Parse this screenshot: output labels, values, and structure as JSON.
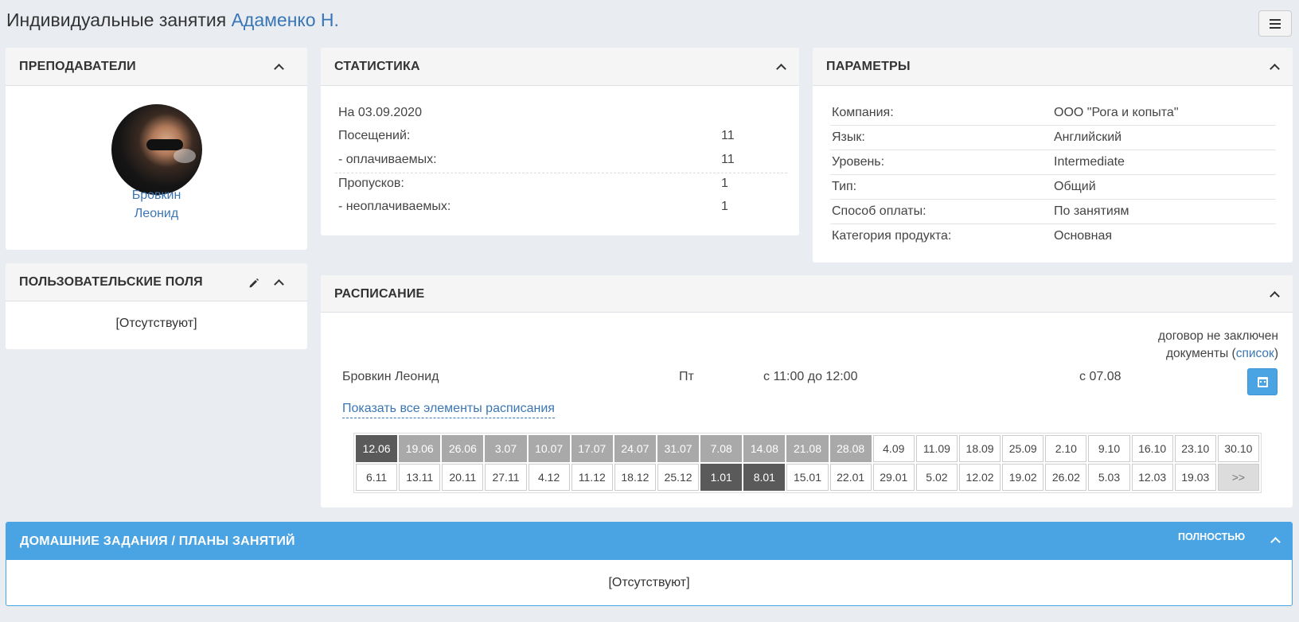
{
  "header": {
    "title_prefix": "Индивидуальные занятия",
    "title_student": "Адаменко Н."
  },
  "teachers": {
    "title": "ПРЕПОДАВАТЕЛИ",
    "first_name": "Бровкин",
    "last_name": "Леонид"
  },
  "user_fields": {
    "title": "ПОЛЬЗОВАТЕЛЬСКИЕ ПОЛЯ",
    "empty": "[Отсутствуют]"
  },
  "stats": {
    "title": "СТАТИСТИКА",
    "date_line": "На 03.09.2020",
    "rows": [
      {
        "label": "Посещений:",
        "value": "11"
      },
      {
        "label": "- оплачиваемых:",
        "value": "11"
      },
      {
        "label": "Пропусков:",
        "value": "1"
      },
      {
        "label": "- неоплачиваемых:",
        "value": "1"
      }
    ]
  },
  "params": {
    "title": "ПАРАМЕТРЫ",
    "rows": [
      {
        "label": "Компания:",
        "value": "ООО \"Рога и копыта\""
      },
      {
        "label": "Язык:",
        "value": "Английский"
      },
      {
        "label": "Уровень:",
        "value": "Intermediate"
      },
      {
        "label": "Тип:",
        "value": "Общий"
      },
      {
        "label": "Способ оплаты:",
        "value": "По занятиям"
      },
      {
        "label": "Категория продукта:",
        "value": "Основная"
      }
    ]
  },
  "schedule": {
    "title": "РАСПИСАНИЕ",
    "contract": "договор не заключен",
    "docs_prefix": "документы (",
    "docs_link": "список",
    "docs_suffix": ")",
    "teacher": "Бровкин Леонид",
    "day": "Пт",
    "time": "с 11:00 до 12:00",
    "since": "с 07.08",
    "show_all": "Показать все элементы расписания",
    "dates_row1": [
      {
        "d": "12.06",
        "s": "cur"
      },
      {
        "d": "19.06",
        "s": "past"
      },
      {
        "d": "26.06",
        "s": "past"
      },
      {
        "d": "3.07",
        "s": "past"
      },
      {
        "d": "10.07",
        "s": "past"
      },
      {
        "d": "17.07",
        "s": "past"
      },
      {
        "d": "24.07",
        "s": "past"
      },
      {
        "d": "31.07",
        "s": "past"
      },
      {
        "d": "7.08",
        "s": "past"
      },
      {
        "d": "14.08",
        "s": "past"
      },
      {
        "d": "21.08",
        "s": "past"
      },
      {
        "d": "28.08",
        "s": "past"
      },
      {
        "d": "4.09",
        "s": ""
      },
      {
        "d": "11.09",
        "s": ""
      },
      {
        "d": "18.09",
        "s": ""
      },
      {
        "d": "25.09",
        "s": ""
      },
      {
        "d": "2.10",
        "s": ""
      },
      {
        "d": "9.10",
        "s": ""
      },
      {
        "d": "16.10",
        "s": ""
      },
      {
        "d": "23.10",
        "s": ""
      },
      {
        "d": "30.10",
        "s": ""
      }
    ],
    "dates_row2": [
      {
        "d": "6.11",
        "s": ""
      },
      {
        "d": "13.11",
        "s": ""
      },
      {
        "d": "20.11",
        "s": ""
      },
      {
        "d": "27.11",
        "s": ""
      },
      {
        "d": "4.12",
        "s": ""
      },
      {
        "d": "11.12",
        "s": ""
      },
      {
        "d": "18.12",
        "s": ""
      },
      {
        "d": "25.12",
        "s": ""
      },
      {
        "d": "1.01",
        "s": "cur"
      },
      {
        "d": "8.01",
        "s": "cur"
      },
      {
        "d": "15.01",
        "s": ""
      },
      {
        "d": "22.01",
        "s": ""
      },
      {
        "d": "29.01",
        "s": ""
      },
      {
        "d": "5.02",
        "s": ""
      },
      {
        "d": "12.02",
        "s": ""
      },
      {
        "d": "19.02",
        "s": ""
      },
      {
        "d": "26.02",
        "s": ""
      },
      {
        "d": "5.03",
        "s": ""
      },
      {
        "d": "12.03",
        "s": ""
      },
      {
        "d": "19.03",
        "s": ""
      },
      {
        "d": ">>",
        "s": "more"
      }
    ]
  },
  "homework": {
    "title": "ДОМАШНИЕ ЗАДАНИЯ / ПЛАНЫ ЗАНЯТИЙ",
    "full_label": "ПОЛНОСТЬЮ",
    "empty": "[Отсутствуют]"
  },
  "icons": {
    "menu": "hamburger-icon",
    "collapse": "chevron-up-icon",
    "edit": "pencil-icon",
    "calendar": "calendar-icon"
  }
}
